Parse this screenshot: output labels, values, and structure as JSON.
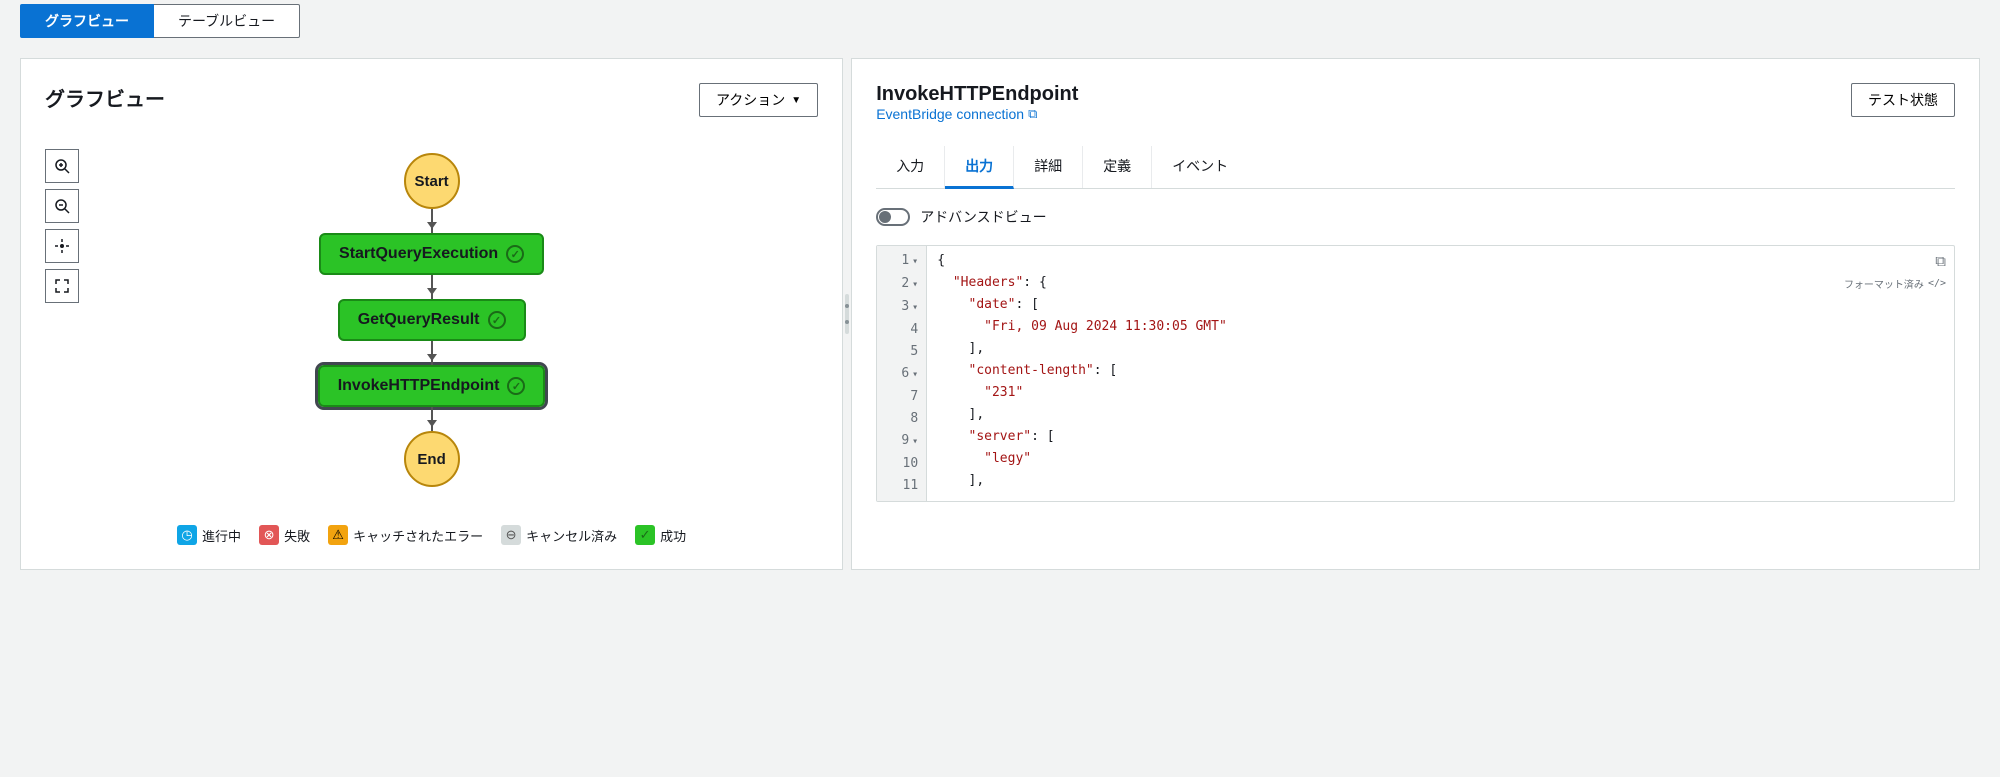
{
  "viewTabs": {
    "graph": "グラフビュー",
    "table": "テーブルビュー"
  },
  "leftPanel": {
    "title": "グラフビュー",
    "actionButton": "アクション"
  },
  "graph": {
    "start": "Start",
    "end": "End",
    "nodes": [
      {
        "label": "StartQueryExecution"
      },
      {
        "label": "GetQueryResult"
      },
      {
        "label": "InvokeHTTPEndpoint"
      }
    ]
  },
  "legend": {
    "progress": "進行中",
    "fail": "失敗",
    "caught": "キャッチされたエラー",
    "cancel": "キャンセル済み",
    "success": "成功"
  },
  "rightPanel": {
    "title": "InvokeHTTPEndpoint",
    "link": "EventBridge connection",
    "testButton": "テスト状態"
  },
  "detailTabs": {
    "input": "入力",
    "output": "出力",
    "details": "詳細",
    "definition": "定義",
    "events": "イベント"
  },
  "advancedView": "アドバンスドビュー",
  "formatted": "フォーマット済み",
  "code": {
    "lines": [
      {
        "num": "1",
        "fold": true,
        "indent": 0,
        "text": "{"
      },
      {
        "num": "2",
        "fold": true,
        "indent": 1,
        "key": "\"Headers\"",
        "after": ": {"
      },
      {
        "num": "3",
        "fold": true,
        "indent": 2,
        "key": "\"date\"",
        "after": ": ["
      },
      {
        "num": "4",
        "fold": false,
        "indent": 3,
        "str": "\"Fri, 09 Aug 2024 11:30:05 GMT\""
      },
      {
        "num": "5",
        "fold": false,
        "indent": 2,
        "text": "],"
      },
      {
        "num": "6",
        "fold": true,
        "indent": 2,
        "key": "\"content-length\"",
        "after": ": ["
      },
      {
        "num": "7",
        "fold": false,
        "indent": 3,
        "str": "\"231\""
      },
      {
        "num": "8",
        "fold": false,
        "indent": 2,
        "text": "],"
      },
      {
        "num": "9",
        "fold": true,
        "indent": 2,
        "key": "\"server\"",
        "after": ": ["
      },
      {
        "num": "10",
        "fold": false,
        "indent": 3,
        "str": "\"legy\""
      },
      {
        "num": "11",
        "fold": false,
        "indent": 2,
        "text": "],"
      }
    ]
  }
}
